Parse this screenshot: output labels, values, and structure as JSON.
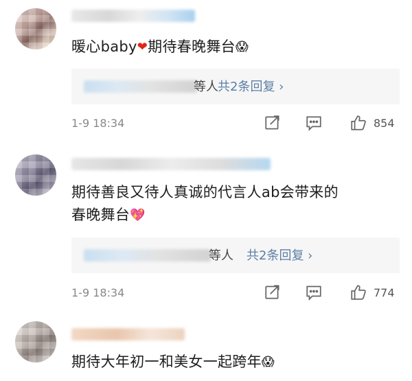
{
  "comments": [
    {
      "text_main": "暖心baby",
      "text_tail": "期待春晚舞台",
      "emoji_1": "❤",
      "emoji_2": "😱",
      "reply_suffix": "等人",
      "reply_count": "共2条回复 ›",
      "time": "1-9 18:34",
      "likes": "854"
    },
    {
      "line1": "期待善良又待人真诚的代言人ab会带来的",
      "line2": "春晚舞台",
      "emoji": "💖",
      "reply_suffix": "等人",
      "reply_count": "共2条回复 ›",
      "time": "1-9 18:34",
      "likes": "774"
    },
    {
      "text": "期待大年初一和美女一起跨年",
      "emoji": "😱"
    }
  ],
  "icons": [
    "share-icon",
    "comment-icon",
    "like-icon"
  ],
  "colors": {
    "link": "#5b7fa6",
    "heart": "#e0251b",
    "reply_bg": "#f6f6f6"
  }
}
